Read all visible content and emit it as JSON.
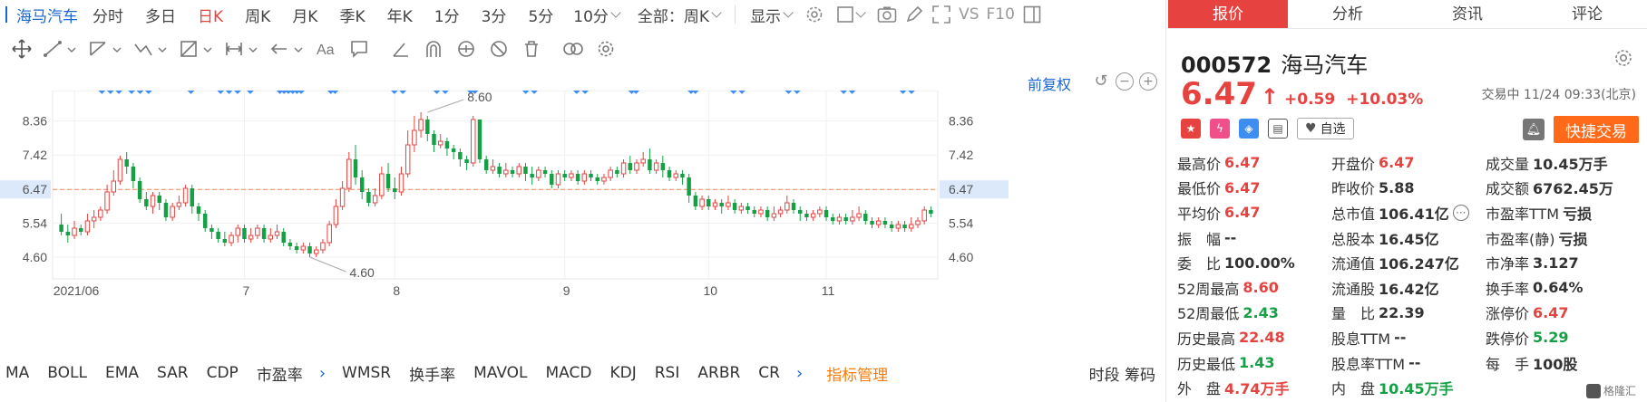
{
  "period_bar": {
    "stock_name": "海马汽车",
    "tabs": [
      "分时",
      "多日",
      "日K",
      "周K",
      "月K",
      "季K",
      "年K",
      "1分",
      "3分",
      "5分",
      "10分"
    ],
    "active_tab": "日K",
    "range_select": "全部：周K",
    "display_select": "显示",
    "vs_label": "VS",
    "f10_label": "F10"
  },
  "chart_head": {
    "adjust_label": "前复权"
  },
  "chart_data": {
    "type": "candlestick",
    "y_ticks": [
      "8.36",
      "7.42",
      "6.47",
      "5.54",
      "4.60"
    ],
    "y_tick_values": [
      8.36,
      7.42,
      6.47,
      5.54,
      4.6
    ],
    "ylim": [
      4.0,
      9.2
    ],
    "x_labels": [
      "2021/06",
      "7",
      "8",
      "9",
      "10",
      "11"
    ],
    "x_label_index": [
      2,
      28,
      51,
      77,
      99,
      117
    ],
    "reference_price": 6.47,
    "reference_label": "6.47",
    "high_annotation": "8.60",
    "high_index": 56,
    "high_value": 8.6,
    "low_annotation": "4.60",
    "low_index": 38,
    "low_value": 4.6,
    "candles": [
      [
        5.5,
        5.3,
        5.8,
        5.2
      ],
      [
        5.3,
        5.2,
        5.5,
        5.0
      ],
      [
        5.2,
        5.4,
        5.6,
        5.1
      ],
      [
        5.4,
        5.3,
        5.5,
        5.2
      ],
      [
        5.3,
        5.6,
        5.8,
        5.2
      ],
      [
        5.6,
        5.7,
        5.9,
        5.4
      ],
      [
        5.7,
        5.9,
        6.0,
        5.6
      ],
      [
        5.9,
        6.4,
        6.6,
        5.8
      ],
      [
        6.4,
        6.7,
        7.0,
        6.3
      ],
      [
        6.7,
        7.3,
        7.4,
        6.6
      ],
      [
        7.3,
        7.1,
        7.5,
        6.9
      ],
      [
        7.1,
        6.7,
        7.2,
        6.5
      ],
      [
        6.7,
        6.2,
        6.8,
        6.1
      ],
      [
        6.2,
        6.0,
        6.4,
        5.9
      ],
      [
        6.0,
        6.3,
        6.4,
        5.8
      ],
      [
        6.3,
        6.1,
        6.4,
        5.9
      ],
      [
        6.1,
        5.7,
        6.2,
        5.6
      ],
      [
        5.7,
        6.0,
        6.1,
        5.6
      ],
      [
        6.0,
        6.1,
        6.3,
        5.9
      ],
      [
        6.1,
        6.5,
        6.6,
        6.0
      ],
      [
        6.5,
        6.0,
        6.6,
        5.8
      ],
      [
        6.0,
        5.8,
        6.1,
        5.6
      ],
      [
        5.8,
        5.4,
        5.9,
        5.3
      ],
      [
        5.4,
        5.3,
        5.5,
        5.1
      ],
      [
        5.3,
        5.1,
        5.4,
        5.0
      ],
      [
        5.1,
        5.0,
        5.3,
        4.9
      ],
      [
        5.0,
        5.2,
        5.3,
        4.9
      ],
      [
        5.2,
        5.4,
        5.5,
        5.0
      ],
      [
        5.4,
        5.1,
        5.5,
        5.0
      ],
      [
        5.1,
        5.2,
        5.4,
        5.0
      ],
      [
        5.2,
        5.4,
        5.5,
        5.1
      ],
      [
        5.4,
        5.1,
        5.5,
        5.0
      ],
      [
        5.1,
        5.2,
        5.4,
        5.0
      ],
      [
        5.2,
        5.3,
        5.5,
        5.1
      ],
      [
        5.3,
        5.0,
        5.4,
        4.9
      ],
      [
        5.0,
        4.9,
        5.1,
        4.8
      ],
      [
        4.9,
        4.8,
        5.0,
        4.7
      ],
      [
        4.8,
        4.9,
        5.0,
        4.7
      ],
      [
        4.9,
        4.7,
        5.0,
        4.6
      ],
      [
        4.7,
        4.8,
        4.9,
        4.6
      ],
      [
        4.8,
        5.0,
        5.1,
        4.7
      ],
      [
        5.0,
        5.5,
        5.6,
        4.9
      ],
      [
        5.5,
        6.0,
        6.2,
        5.4
      ],
      [
        6.0,
        6.5,
        6.7,
        5.9
      ],
      [
        6.5,
        7.3,
        7.5,
        6.4
      ],
      [
        7.3,
        6.8,
        7.7,
        6.6
      ],
      [
        6.8,
        6.4,
        7.0,
        6.2
      ],
      [
        6.4,
        6.1,
        6.5,
        6.0
      ],
      [
        6.1,
        6.3,
        6.5,
        6.0
      ],
      [
        6.3,
        6.9,
        7.1,
        6.2
      ],
      [
        6.9,
        6.5,
        7.2,
        6.4
      ],
      [
        6.5,
        6.4,
        6.8,
        6.2
      ],
      [
        6.4,
        6.9,
        7.1,
        6.3
      ],
      [
        6.9,
        7.7,
        8.1,
        6.8
      ],
      [
        7.7,
        8.1,
        8.5,
        7.5
      ],
      [
        8.1,
        8.4,
        8.6,
        7.9
      ],
      [
        8.4,
        8.0,
        8.5,
        7.8
      ],
      [
        8.0,
        7.7,
        8.1,
        7.5
      ],
      [
        7.7,
        7.8,
        8.0,
        7.6
      ],
      [
        7.8,
        7.6,
        7.9,
        7.4
      ],
      [
        7.6,
        7.5,
        7.7,
        7.3
      ],
      [
        7.5,
        7.3,
        7.6,
        7.1
      ],
      [
        7.3,
        7.2,
        7.4,
        7.0
      ],
      [
        7.2,
        8.4,
        8.5,
        7.1
      ],
      [
        8.4,
        7.3,
        8.4,
        7.2
      ],
      [
        7.3,
        7.0,
        7.4,
        6.9
      ],
      [
        7.0,
        7.1,
        7.3,
        6.9
      ],
      [
        7.1,
        6.9,
        7.2,
        6.8
      ],
      [
        6.9,
        7.0,
        7.2,
        6.8
      ],
      [
        7.0,
        6.9,
        7.1,
        6.8
      ],
      [
        6.9,
        7.1,
        7.2,
        6.8
      ],
      [
        7.1,
        6.9,
        7.2,
        6.7
      ],
      [
        6.9,
        6.8,
        7.1,
        6.6
      ],
      [
        6.8,
        7.0,
        7.1,
        6.7
      ],
      [
        7.0,
        6.9,
        7.1,
        6.8
      ],
      [
        6.9,
        6.6,
        7.0,
        6.5
      ],
      [
        6.6,
        6.9,
        7.0,
        6.5
      ],
      [
        6.9,
        6.8,
        7.0,
        6.7
      ],
      [
        6.8,
        6.9,
        7.0,
        6.7
      ],
      [
        6.9,
        6.7,
        7.0,
        6.6
      ],
      [
        6.7,
        6.9,
        7.0,
        6.6
      ],
      [
        6.9,
        6.8,
        7.0,
        6.7
      ],
      [
        6.8,
        6.7,
        6.9,
        6.6
      ],
      [
        6.7,
        6.8,
        6.9,
        6.6
      ],
      [
        6.8,
        7.0,
        7.1,
        6.7
      ],
      [
        7.0,
        6.9,
        7.1,
        6.8
      ],
      [
        6.9,
        7.2,
        7.3,
        6.8
      ],
      [
        7.2,
        7.0,
        7.4,
        6.9
      ],
      [
        7.0,
        7.2,
        7.3,
        6.9
      ],
      [
        7.2,
        7.3,
        7.5,
        7.1
      ],
      [
        7.3,
        7.0,
        7.6,
        6.9
      ],
      [
        7.0,
        7.2,
        7.3,
        6.9
      ],
      [
        7.2,
        7.0,
        7.4,
        6.8
      ],
      [
        7.0,
        6.8,
        7.1,
        6.7
      ],
      [
        6.8,
        6.9,
        7.0,
        6.7
      ],
      [
        6.9,
        6.8,
        7.0,
        6.6
      ],
      [
        6.8,
        6.3,
        6.9,
        6.1
      ],
      [
        6.3,
        6.0,
        6.4,
        5.9
      ],
      [
        6.0,
        6.2,
        6.3,
        5.9
      ],
      [
        6.2,
        6.0,
        6.3,
        5.9
      ],
      [
        6.0,
        6.1,
        6.2,
        5.9
      ],
      [
        6.1,
        6.0,
        6.2,
        5.8
      ],
      [
        6.0,
        6.1,
        6.3,
        5.9
      ],
      [
        6.1,
        5.9,
        6.2,
        5.8
      ],
      [
        5.9,
        6.0,
        6.1,
        5.8
      ],
      [
        6.0,
        5.9,
        6.1,
        5.8
      ],
      [
        5.9,
        5.8,
        6.0,
        5.7
      ],
      [
        5.8,
        5.9,
        6.0,
        5.7
      ],
      [
        5.9,
        5.7,
        6.0,
        5.6
      ],
      [
        5.7,
        5.8,
        6.0,
        5.6
      ],
      [
        5.8,
        5.9,
        6.0,
        5.7
      ],
      [
        5.9,
        6.1,
        6.3,
        5.8
      ],
      [
        6.1,
        5.9,
        6.2,
        5.8
      ],
      [
        5.9,
        5.8,
        6.0,
        5.6
      ],
      [
        5.8,
        5.7,
        5.9,
        5.6
      ],
      [
        5.7,
        5.8,
        5.9,
        5.6
      ],
      [
        5.8,
        5.9,
        6.0,
        5.7
      ],
      [
        5.9,
        5.7,
        6.0,
        5.6
      ],
      [
        5.7,
        5.6,
        5.8,
        5.5
      ],
      [
        5.6,
        5.7,
        5.8,
        5.5
      ],
      [
        5.7,
        5.6,
        5.8,
        5.5
      ],
      [
        5.6,
        5.7,
        5.9,
        5.5
      ],
      [
        5.7,
        5.8,
        6.0,
        5.6
      ],
      [
        5.8,
        5.6,
        5.9,
        5.5
      ],
      [
        5.6,
        5.5,
        5.7,
        5.4
      ],
      [
        5.5,
        5.6,
        5.7,
        5.4
      ],
      [
        5.6,
        5.5,
        5.7,
        5.4
      ],
      [
        5.5,
        5.4,
        5.6,
        5.3
      ],
      [
        5.4,
        5.5,
        5.6,
        5.3
      ],
      [
        5.5,
        5.4,
        5.6,
        5.3
      ],
      [
        5.4,
        5.5,
        5.7,
        5.3
      ],
      [
        5.5,
        5.6,
        5.7,
        5.4
      ],
      [
        5.6,
        5.9,
        6.0,
        5.5
      ],
      [
        5.9,
        5.8,
        6.0,
        5.7
      ]
    ],
    "markers_index": [
      3,
      5,
      7,
      10,
      12,
      14,
      24,
      31,
      33,
      35,
      38,
      45,
      46,
      47,
      48,
      49,
      50,
      57,
      58,
      72,
      74,
      82,
      84,
      90,
      91,
      103,
      105,
      115,
      117,
      128,
      129,
      142,
      143,
      152,
      154,
      165,
      167,
      178,
      180,
      192,
      194
    ]
  },
  "indicators": {
    "items": [
      "MA",
      "BOLL",
      "EMA",
      "SAR",
      "CDP",
      "市盈率"
    ],
    "items2": [
      "WMSR",
      "换手率",
      "MAVOL",
      "MACD",
      "KDJ",
      "RSI",
      "ARBR",
      "CR"
    ],
    "manager": "指标管理",
    "right": [
      "时段",
      "筹码"
    ]
  },
  "quote": {
    "tabs": [
      "报价",
      "分析",
      "资讯",
      "评论"
    ],
    "active_tab": "报价",
    "code": "000572",
    "name": "海马汽车",
    "price": "6.47",
    "change": "+0.59",
    "change_pct": "+10.03%",
    "status": "交易中 11/24 09:33(北京)",
    "fav_label": "自选",
    "quick_trade": "快捷交易",
    "rows": [
      [
        {
          "l": "最高价",
          "v": "6.47",
          "c": "up"
        },
        {
          "l": "开盘价",
          "v": "6.47",
          "c": "up"
        },
        {
          "l": "成交量",
          "v": "10.45万手",
          "c": "flat"
        }
      ],
      [
        {
          "l": "最低价",
          "v": "6.47",
          "c": "up"
        },
        {
          "l": "昨收价",
          "v": "5.88",
          "c": "flat"
        },
        {
          "l": "成交额",
          "v": "6762.45万",
          "c": "flat"
        }
      ],
      [
        {
          "l": "平均价",
          "v": "6.47",
          "c": "up"
        },
        {
          "l": "总市值",
          "v": "106.41亿",
          "c": "flat",
          "info": true
        },
        {
          "l": "市盈率TTM",
          "v": "亏损",
          "c": "flat"
        }
      ],
      [
        {
          "l": "振　幅",
          "v": "--",
          "c": "flat"
        },
        {
          "l": "总股本",
          "v": "16.45亿",
          "c": "flat"
        },
        {
          "l": "市盈率(静)",
          "v": "亏损",
          "c": "flat"
        }
      ],
      [
        {
          "l": "委　比",
          "v": "100.00%",
          "c": "flat"
        },
        {
          "l": "流通值",
          "v": "106.247亿",
          "c": "flat"
        },
        {
          "l": "市净率",
          "v": "3.127",
          "c": "flat"
        }
      ],
      [
        {
          "l": "52周最高",
          "v": "8.60",
          "c": "up"
        },
        {
          "l": "流通股",
          "v": "16.42亿",
          "c": "flat"
        },
        {
          "l": "换手率",
          "v": "0.64%",
          "c": "flat"
        }
      ],
      [
        {
          "l": "52周最低",
          "v": "2.43",
          "c": "dn"
        },
        {
          "l": "量　比",
          "v": "22.39",
          "c": "flat"
        },
        {
          "l": "涨停价",
          "v": "6.47",
          "c": "up"
        }
      ],
      [
        {
          "l": "历史最高",
          "v": "22.48",
          "c": "up"
        },
        {
          "l": "股息TTM",
          "v": "--",
          "c": "flat"
        },
        {
          "l": "跌停价",
          "v": "5.29",
          "c": "dn"
        }
      ],
      [
        {
          "l": "历史最低",
          "v": "1.43",
          "c": "dn"
        },
        {
          "l": "股息率TTM",
          "v": "--",
          "c": "flat"
        },
        {
          "l": "每　手",
          "v": "100股",
          "c": "flat"
        }
      ],
      [
        {
          "l": "外　盘",
          "v": "4.74万手",
          "c": "up"
        },
        {
          "l": "内　盘",
          "v": "10.45万手",
          "c": "dn"
        },
        {
          "l": "",
          "v": "",
          "c": "flat"
        }
      ]
    ]
  },
  "watermark": "格隆汇",
  "colors": {
    "up": "#e64340",
    "down": "#15a045",
    "accent": "#1a66d6",
    "orange": "#ff6a1a",
    "marker": "#3d8ef0"
  }
}
